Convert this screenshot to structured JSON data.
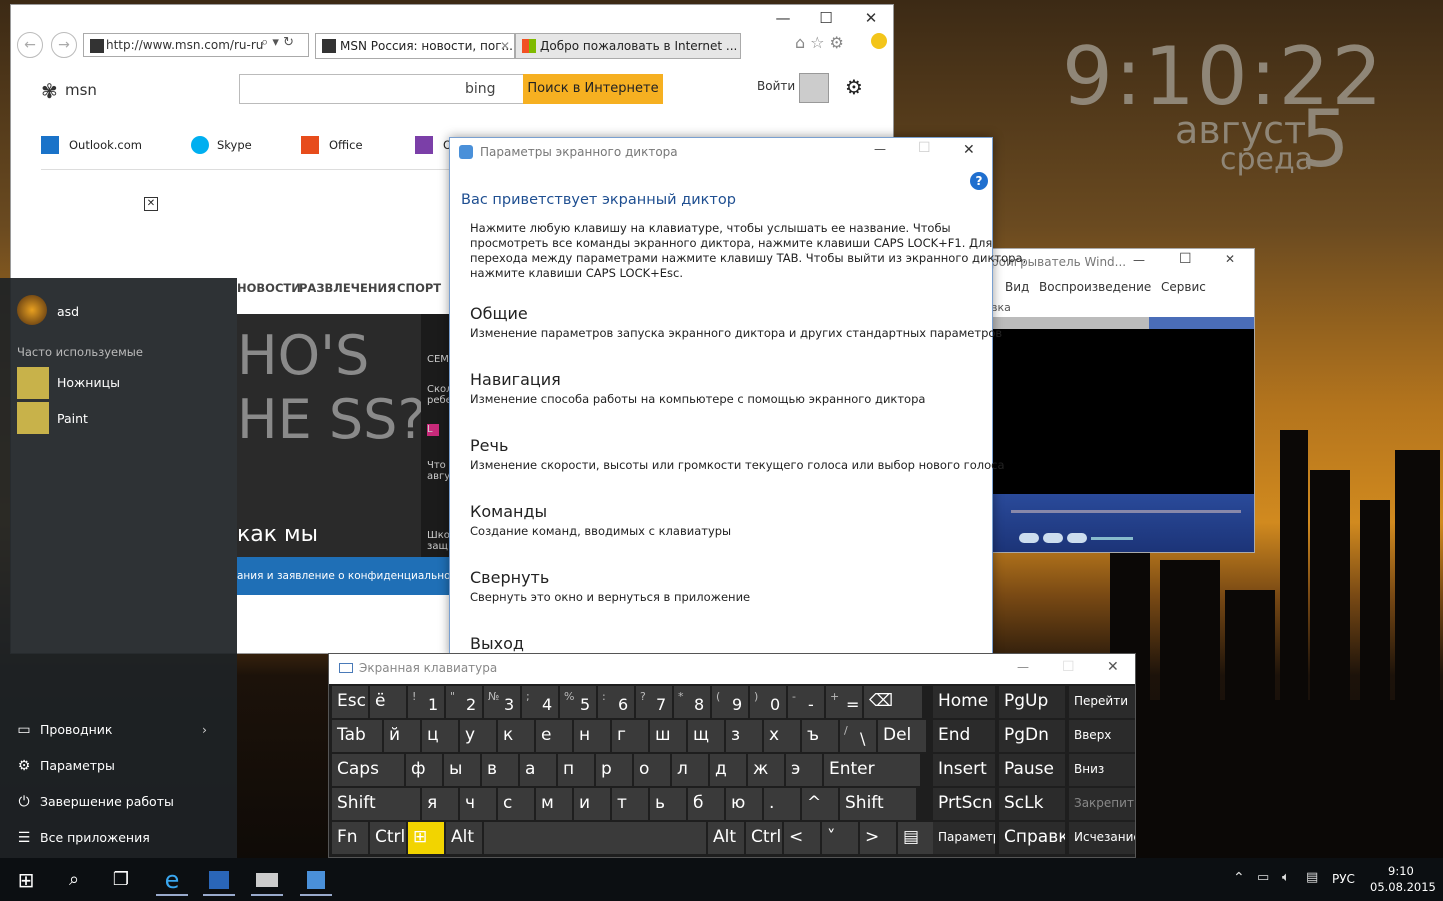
{
  "clock": {
    "time": "9:10:22",
    "month": "август",
    "day": "5",
    "weekday": "среда"
  },
  "ie": {
    "address": "http://www.msn.com/ru-ru",
    "tabs": [
      {
        "label": "MSN Россия: новости, пог..."
      },
      {
        "label": "Добро пожаловать в Internet ..."
      }
    ],
    "msn_logo": "msn",
    "bing_label": "bing",
    "search_button": "Поиск в Интернете",
    "login": "Войти",
    "quicklinks": [
      {
        "label": "Outlook.com"
      },
      {
        "label": "Skype"
      },
      {
        "label": "Office"
      },
      {
        "label": "O"
      }
    ],
    "nav": [
      "НОВОСТИ",
      "РАЗВЛЕЧЕНИЯ",
      "СПОРТ"
    ],
    "hero_text": "как мы",
    "hero_chalk": "HO'S HE SS?",
    "side_snippets": [
      "СЕМ",
      "Скол ребе",
      "L",
      "Что авгу",
      "Шко защ"
    ],
    "privacy_text": "ания и заявление о конфиденциальност"
  },
  "narrator": {
    "title": "Параметры экранного диктора",
    "heading": "Вас приветствует экранный диктор",
    "intro": [
      "Нажмите любую клавишу на клавиатуре, чтобы услышать ее название. Чтобы",
      "просмотреть все команды экранного диктора, нажмите клавиши CAPS LOCK+F1. Для",
      "перехода между параметрами нажмите клавишу TAB. Чтобы выйти из экранного диктора,",
      "нажмите клавиши CAPS LOCK+Esc."
    ],
    "sections": [
      {
        "title": "Общие",
        "desc": "Изменение параметров запуска экранного диктора и других стандартных параметров"
      },
      {
        "title": "Навигация",
        "desc": "Изменение способа работы на компьютере с помощью экранного диктора"
      },
      {
        "title": "Речь",
        "desc": "Изменение скорости, высоты или громкости текущего голоса или выбор нового голоса"
      },
      {
        "title": "Команды",
        "desc": "Создание команд, вводимых с клавиатуры"
      },
      {
        "title": "Свернуть",
        "desc": "Свернуть это окно и вернуться в приложение"
      },
      {
        "title": "Выход",
        "desc": ""
      }
    ]
  },
  "wmp": {
    "title": "роигрыватель Wind...",
    "menu": [
      "Вид",
      "Воспроизведение",
      "Сервис"
    ],
    "submenu": "вка"
  },
  "start": {
    "user": "asd",
    "frequent_label": "Часто используемые",
    "apps": [
      {
        "label": "Ножницы"
      },
      {
        "label": "Paint"
      }
    ],
    "bottom": [
      {
        "label": "Проводник",
        "icon": "folder-icon"
      },
      {
        "label": "Параметры",
        "icon": "gear-icon"
      },
      {
        "label": "Завершение работы",
        "icon": "power-icon"
      },
      {
        "label": "Все приложения",
        "icon": "list-icon"
      }
    ]
  },
  "osk": {
    "title": "Экранная клавиатура",
    "row1": [
      {
        "k": "Esc"
      },
      {
        "k": "ё"
      },
      {
        "s": "!",
        "k": "1"
      },
      {
        "s": "\"",
        "k": "2"
      },
      {
        "s": "№",
        "k": "3"
      },
      {
        "s": ";",
        "k": "4"
      },
      {
        "s": "%",
        "k": "5"
      },
      {
        "s": ":",
        "k": "6"
      },
      {
        "s": "?",
        "k": "7"
      },
      {
        "s": "*",
        "k": "8"
      },
      {
        "s": "(",
        "k": "9"
      },
      {
        "s": ")",
        "k": "0"
      },
      {
        "s": "-",
        "k": "-"
      },
      {
        "s": "+",
        "k": "="
      },
      {
        "k": "⌫"
      }
    ],
    "row2": [
      {
        "k": "Tab"
      },
      {
        "k": "й"
      },
      {
        "k": "ц"
      },
      {
        "k": "у"
      },
      {
        "k": "к"
      },
      {
        "k": "е"
      },
      {
        "k": "н"
      },
      {
        "k": "г"
      },
      {
        "k": "ш"
      },
      {
        "k": "щ"
      },
      {
        "k": "з"
      },
      {
        "k": "х"
      },
      {
        "k": "ъ"
      },
      {
        "s": "/",
        "k": "\\"
      },
      {
        "k": "Del"
      }
    ],
    "row3": [
      {
        "k": "Caps"
      },
      {
        "k": "ф"
      },
      {
        "k": "ы"
      },
      {
        "k": "в"
      },
      {
        "k": "а"
      },
      {
        "k": "п"
      },
      {
        "k": "р"
      },
      {
        "k": "о"
      },
      {
        "k": "л"
      },
      {
        "k": "д"
      },
      {
        "k": "ж"
      },
      {
        "k": "э"
      },
      {
        "k": "Enter"
      }
    ],
    "row4": [
      {
        "k": "Shift"
      },
      {
        "k": "я"
      },
      {
        "k": "ч"
      },
      {
        "k": "с"
      },
      {
        "k": "м"
      },
      {
        "k": "и"
      },
      {
        "k": "т"
      },
      {
        "k": "ь"
      },
      {
        "k": "б"
      },
      {
        "k": "ю"
      },
      {
        "k": "."
      },
      {
        "k": "^"
      },
      {
        "k": "Shift"
      }
    ],
    "row5": [
      {
        "k": "Fn"
      },
      {
        "k": "Ctrl"
      },
      {
        "k": "⊞"
      },
      {
        "k": "Alt"
      },
      {
        "k": ""
      },
      {
        "k": "Alt"
      },
      {
        "k": "Ctrl"
      },
      {
        "k": "<"
      },
      {
        "k": "˅"
      },
      {
        "k": ">"
      },
      {
        "k": "▤"
      }
    ],
    "nav": [
      [
        "Home",
        "PgUp",
        "Перейти"
      ],
      [
        "End",
        "PgDn",
        "Вверх"
      ],
      [
        "Insert",
        "Pause",
        "Вниз"
      ],
      [
        "PrtScn",
        "ScLk",
        "Закрепить"
      ],
      [
        "Параметры",
        "Справка",
        "Исчезание"
      ]
    ]
  },
  "taskbar": {
    "lang": "РУС",
    "time": "9:10",
    "date": "05.08.2015"
  }
}
